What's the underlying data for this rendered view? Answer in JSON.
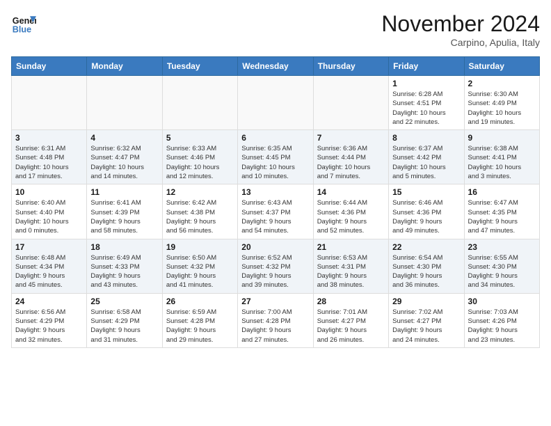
{
  "header": {
    "logo_line1": "General",
    "logo_line2": "Blue",
    "month_title": "November 2024",
    "location": "Carpino, Apulia, Italy"
  },
  "days_of_week": [
    "Sunday",
    "Monday",
    "Tuesday",
    "Wednesday",
    "Thursday",
    "Friday",
    "Saturday"
  ],
  "weeks": [
    [
      {
        "day": "",
        "info": ""
      },
      {
        "day": "",
        "info": ""
      },
      {
        "day": "",
        "info": ""
      },
      {
        "day": "",
        "info": ""
      },
      {
        "day": "",
        "info": ""
      },
      {
        "day": "1",
        "info": "Sunrise: 6:28 AM\nSunset: 4:51 PM\nDaylight: 10 hours\nand 22 minutes."
      },
      {
        "day": "2",
        "info": "Sunrise: 6:30 AM\nSunset: 4:49 PM\nDaylight: 10 hours\nand 19 minutes."
      }
    ],
    [
      {
        "day": "3",
        "info": "Sunrise: 6:31 AM\nSunset: 4:48 PM\nDaylight: 10 hours\nand 17 minutes."
      },
      {
        "day": "4",
        "info": "Sunrise: 6:32 AM\nSunset: 4:47 PM\nDaylight: 10 hours\nand 14 minutes."
      },
      {
        "day": "5",
        "info": "Sunrise: 6:33 AM\nSunset: 4:46 PM\nDaylight: 10 hours\nand 12 minutes."
      },
      {
        "day": "6",
        "info": "Sunrise: 6:35 AM\nSunset: 4:45 PM\nDaylight: 10 hours\nand 10 minutes."
      },
      {
        "day": "7",
        "info": "Sunrise: 6:36 AM\nSunset: 4:44 PM\nDaylight: 10 hours\nand 7 minutes."
      },
      {
        "day": "8",
        "info": "Sunrise: 6:37 AM\nSunset: 4:42 PM\nDaylight: 10 hours\nand 5 minutes."
      },
      {
        "day": "9",
        "info": "Sunrise: 6:38 AM\nSunset: 4:41 PM\nDaylight: 10 hours\nand 3 minutes."
      }
    ],
    [
      {
        "day": "10",
        "info": "Sunrise: 6:40 AM\nSunset: 4:40 PM\nDaylight: 10 hours\nand 0 minutes."
      },
      {
        "day": "11",
        "info": "Sunrise: 6:41 AM\nSunset: 4:39 PM\nDaylight: 9 hours\nand 58 minutes."
      },
      {
        "day": "12",
        "info": "Sunrise: 6:42 AM\nSunset: 4:38 PM\nDaylight: 9 hours\nand 56 minutes."
      },
      {
        "day": "13",
        "info": "Sunrise: 6:43 AM\nSunset: 4:37 PM\nDaylight: 9 hours\nand 54 minutes."
      },
      {
        "day": "14",
        "info": "Sunrise: 6:44 AM\nSunset: 4:36 PM\nDaylight: 9 hours\nand 52 minutes."
      },
      {
        "day": "15",
        "info": "Sunrise: 6:46 AM\nSunset: 4:36 PM\nDaylight: 9 hours\nand 49 minutes."
      },
      {
        "day": "16",
        "info": "Sunrise: 6:47 AM\nSunset: 4:35 PM\nDaylight: 9 hours\nand 47 minutes."
      }
    ],
    [
      {
        "day": "17",
        "info": "Sunrise: 6:48 AM\nSunset: 4:34 PM\nDaylight: 9 hours\nand 45 minutes."
      },
      {
        "day": "18",
        "info": "Sunrise: 6:49 AM\nSunset: 4:33 PM\nDaylight: 9 hours\nand 43 minutes."
      },
      {
        "day": "19",
        "info": "Sunrise: 6:50 AM\nSunset: 4:32 PM\nDaylight: 9 hours\nand 41 minutes."
      },
      {
        "day": "20",
        "info": "Sunrise: 6:52 AM\nSunset: 4:32 PM\nDaylight: 9 hours\nand 39 minutes."
      },
      {
        "day": "21",
        "info": "Sunrise: 6:53 AM\nSunset: 4:31 PM\nDaylight: 9 hours\nand 38 minutes."
      },
      {
        "day": "22",
        "info": "Sunrise: 6:54 AM\nSunset: 4:30 PM\nDaylight: 9 hours\nand 36 minutes."
      },
      {
        "day": "23",
        "info": "Sunrise: 6:55 AM\nSunset: 4:30 PM\nDaylight: 9 hours\nand 34 minutes."
      }
    ],
    [
      {
        "day": "24",
        "info": "Sunrise: 6:56 AM\nSunset: 4:29 PM\nDaylight: 9 hours\nand 32 minutes."
      },
      {
        "day": "25",
        "info": "Sunrise: 6:58 AM\nSunset: 4:29 PM\nDaylight: 9 hours\nand 31 minutes."
      },
      {
        "day": "26",
        "info": "Sunrise: 6:59 AM\nSunset: 4:28 PM\nDaylight: 9 hours\nand 29 minutes."
      },
      {
        "day": "27",
        "info": "Sunrise: 7:00 AM\nSunset: 4:28 PM\nDaylight: 9 hours\nand 27 minutes."
      },
      {
        "day": "28",
        "info": "Sunrise: 7:01 AM\nSunset: 4:27 PM\nDaylight: 9 hours\nand 26 minutes."
      },
      {
        "day": "29",
        "info": "Sunrise: 7:02 AM\nSunset: 4:27 PM\nDaylight: 9 hours\nand 24 minutes."
      },
      {
        "day": "30",
        "info": "Sunrise: 7:03 AM\nSunset: 4:26 PM\nDaylight: 9 hours\nand 23 minutes."
      }
    ]
  ]
}
